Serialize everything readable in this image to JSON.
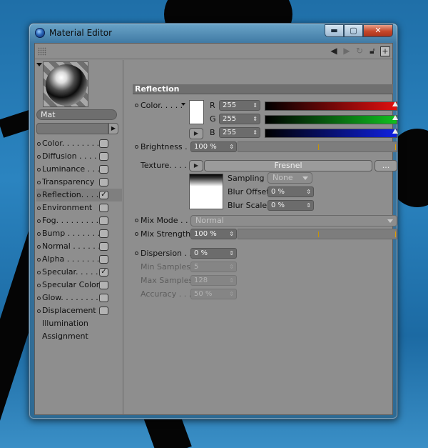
{
  "window": {
    "title": "Material Editor"
  },
  "titlebar_buttons": {
    "minimize": "▬",
    "maximize": "▢",
    "close": "✕"
  },
  "material": {
    "name": "Mat"
  },
  "channels": [
    {
      "label": "Color. . . . . . . .",
      "checked": false
    },
    {
      "label": "Diffusion . . . . .",
      "checked": false
    },
    {
      "label": "Luminance . . . .",
      "checked": false
    },
    {
      "label": "Transparency",
      "checked": false
    },
    {
      "label": "Reflection. . . .",
      "checked": true
    },
    {
      "label": "Environment",
      "checked": false
    },
    {
      "label": "Fog. . . . . . . . .",
      "checked": false
    },
    {
      "label": "Bump . . . . . . .",
      "checked": false
    },
    {
      "label": "Normal . . . . . .",
      "checked": false
    },
    {
      "label": "Alpha . . . . . . .",
      "checked": false
    },
    {
      "label": "Specular. . . . .",
      "checked": true
    },
    {
      "label": "Specular Color",
      "checked": false
    },
    {
      "label": "Glow. . . . . . . .",
      "checked": false
    },
    {
      "label": "Displacement",
      "checked": false
    }
  ],
  "extra_items": [
    "Illumination",
    "Assignment"
  ],
  "check_glyph": "✓",
  "reflection": {
    "header": "Reflection",
    "color_label": "Color. . . . .",
    "r_label": "R",
    "r_value": "255",
    "g_label": "G",
    "g_value": "255",
    "b_label": "B",
    "b_value": "255",
    "brightness_label": "Brightness . .",
    "brightness_value": "100 %",
    "texture_label": "Texture. . . . .",
    "texture_name": "Fresnel",
    "texture_more": "...",
    "sampling_label": "Sampling",
    "sampling_value": "None",
    "blur_offset_label": "Blur Offset",
    "blur_offset_value": "0 %",
    "blur_scale_label": "Blur Scale",
    "blur_scale_value": "0 %",
    "mix_mode_label": "Mix Mode . . .",
    "mix_mode_value": "Normal",
    "mix_strength_label": "Mix Strength",
    "mix_strength_value": "100 %",
    "dispersion_label": "Dispersion . .",
    "dispersion_value": "0 %",
    "min_samples_label": "Min Samples",
    "min_samples_value": "5",
    "max_samples_label": "Max Samples",
    "max_samples_value": "128",
    "accuracy_label": "Accuracy . . .",
    "accuracy_value": "50 %"
  },
  "colors": {
    "red": "#e01010",
    "green": "#10c020",
    "blue": "#1020e0"
  }
}
